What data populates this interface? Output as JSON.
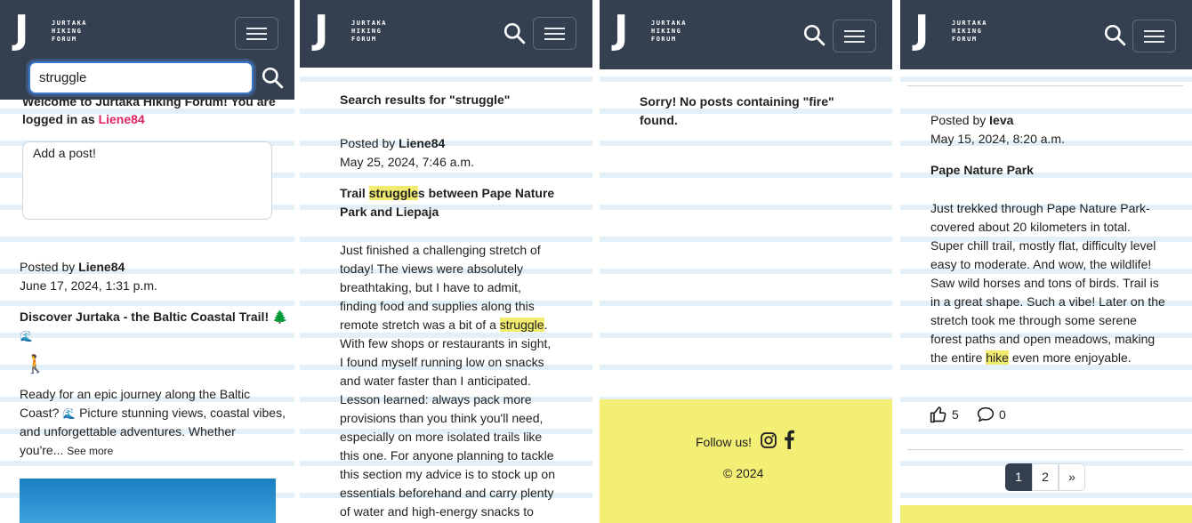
{
  "brand": {
    "letter": "J",
    "line1": "JURTAKA",
    "line2": "HIKING",
    "line3": "FORUM"
  },
  "icons": {
    "search": "search-icon",
    "menu": "hamburger-icon",
    "hiker": "hiker-emoji",
    "wave": "wave-emoji",
    "tree": "tree-emoji",
    "like": "thumbs-up-icon",
    "comment": "comment-icon",
    "instagram": "instagram-icon",
    "facebook": "facebook-icon"
  },
  "colors": {
    "navbar": "#344050",
    "highlight": "#f1ec70",
    "username": "#e0245e",
    "footer": "#f3ee74"
  },
  "panel1": {
    "search_value": "struggle",
    "welcome_line1": "Welcome to Jurtaka Hiking Forum! You are",
    "welcome_prefix": "logged in as ",
    "welcome_user": "Liene84",
    "post_placeholder": "Add a post!",
    "post": {
      "posted_by_label": "Posted by ",
      "author": "Liene84",
      "date": "June 17, 2024, 1:31 p.m.",
      "title": "Discover Jurtaka - the Baltic Coastal Trail! 🌲",
      "title_emoji2": "🌊",
      "hiker": "🚶",
      "body_line1": "Ready for an epic journey along the Baltic",
      "body_line2a": "Coast? ",
      "body_line2_emoji": "🌊",
      "body_line2b": " Picture stunning views, coastal vibes,",
      "body_line3": "and unforgettable adventures. Whether",
      "body_line4": "you're... ",
      "see_more": "See more"
    }
  },
  "panel2": {
    "results_heading": "Search results for \"struggle\"",
    "posted_by_label": "Posted by ",
    "author": "Liene84",
    "date": "May 25, 2024, 7:46 a.m.",
    "title_pre": "Trail ",
    "title_hl": "struggle",
    "title_post": "s between Pape Nature",
    "title_line2": "Park and Liepaja",
    "body": [
      "Just finished a challenging stretch of",
      "today! The views were absolutely",
      "breathtaking, but I have to admit,",
      "finding food and supplies along this"
    ],
    "body_hl_pre": "remote stretch was a bit of a ",
    "body_hl": "struggle",
    "body_hl_post": ".",
    "body_rest": [
      "With few shops or restaurants in sight,",
      "I found myself running low on snacks",
      "and water faster than I anticipated.",
      "Lesson learned: always pack more",
      "provisions than you think you'll need,",
      "especially on more isolated trails like",
      "this one. For anyone planning to tackle",
      "this section my advice is to stock up on",
      "essentials beforehand and carry plenty",
      "of water and high-energy snacks to"
    ]
  },
  "panel3": {
    "no_results_line1": "Sorry! No posts containing \"fire\"",
    "no_results_line2": "found.",
    "follow_label": "Follow us!",
    "copyright": "© 2024"
  },
  "panel4": {
    "posted_by_label": "Posted by ",
    "author": "Ieva",
    "date": "May 15, 2024, 8:20 a.m.",
    "title": "Pape Nature Park",
    "body": [
      "Just trekked through Pape Nature Park-",
      "covered about 20 kilometers in total.",
      "Super chill trail, mostly flat, difficulty level",
      "easy to moderate. And wow, the wildlife!",
      "Saw wild horses and tons of birds. Trail is",
      "in a great shape. Such a vibe! Later on the",
      "stretch took me through some serene",
      "forest paths and open meadows, making"
    ],
    "body_last_pre": "the entire ",
    "body_last_hl": "hike",
    "body_last_post": " even more enjoyable.",
    "likes": "5",
    "comments": "0",
    "pages": [
      "1",
      "2",
      "»"
    ]
  }
}
